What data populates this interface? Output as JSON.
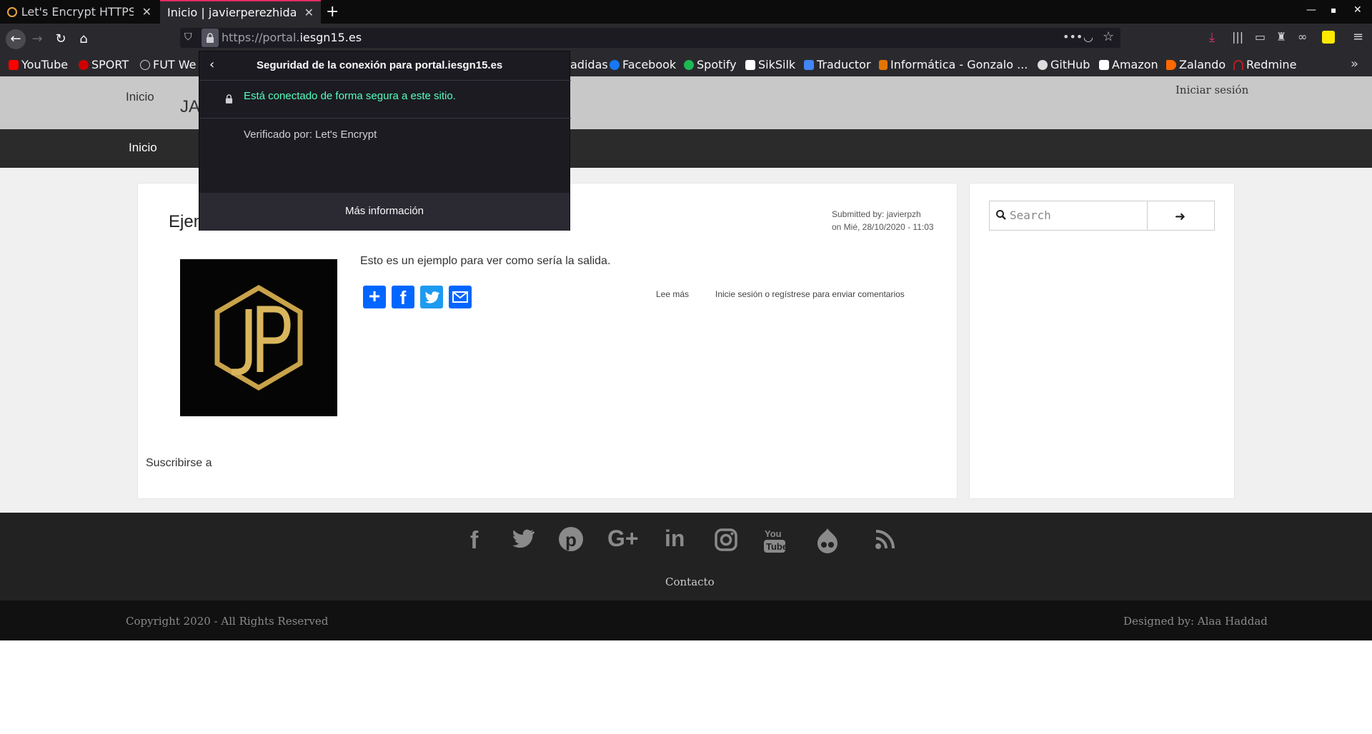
{
  "browser": {
    "tabs": [
      {
        "title": "Let's Encrypt HTTPS |"
      },
      {
        "title": "Inicio | javierperezhidalgo"
      }
    ],
    "url": {
      "prefix": "https://portal.",
      "domain": "iesgn15.es"
    },
    "bookmarks": [
      "YouTube",
      "SPORT",
      "FUT We",
      "adidas",
      "Facebook",
      "Spotify",
      "SikSilk",
      "Traductor",
      "Informática - Gonzalo ...",
      "GitHub",
      "Amazon",
      "Zalando",
      "Redmine"
    ]
  },
  "popup": {
    "title": "Seguridad de la conexión para portal.iesgn15.es",
    "secure_text": "Está conectado de forma segura a este sitio.",
    "verified": "Verificado por: Let's Encrypt",
    "more_info": "Más información"
  },
  "site": {
    "header_inicio": "Inicio",
    "header_brand": "JA",
    "login": "Iniciar sesión",
    "nav_inicio": "Inicio"
  },
  "article": {
    "title_partial": "Ejem",
    "submitted_by": "Submitted by: javierpzh",
    "date": "on Mié, 28/10/2020 - 11:03",
    "body": "Esto es un ejemplo para ver como sería la salida.",
    "read_more": "Lee más",
    "login_comment": "Inicie sesión o regístrese para enviar comentarios",
    "subscribe": "Suscribirse a"
  },
  "search": {
    "placeholder": "Search"
  },
  "footer": {
    "contact": "Contacto",
    "copyright": "Copyright 2020 - All Rights Reserved",
    "designed": "Designed by: Alaa Haddad"
  },
  "colors": {
    "secure_green": "#54ffbd",
    "accent_tab": "#e02d64",
    "share_blue": "#0166ff"
  }
}
